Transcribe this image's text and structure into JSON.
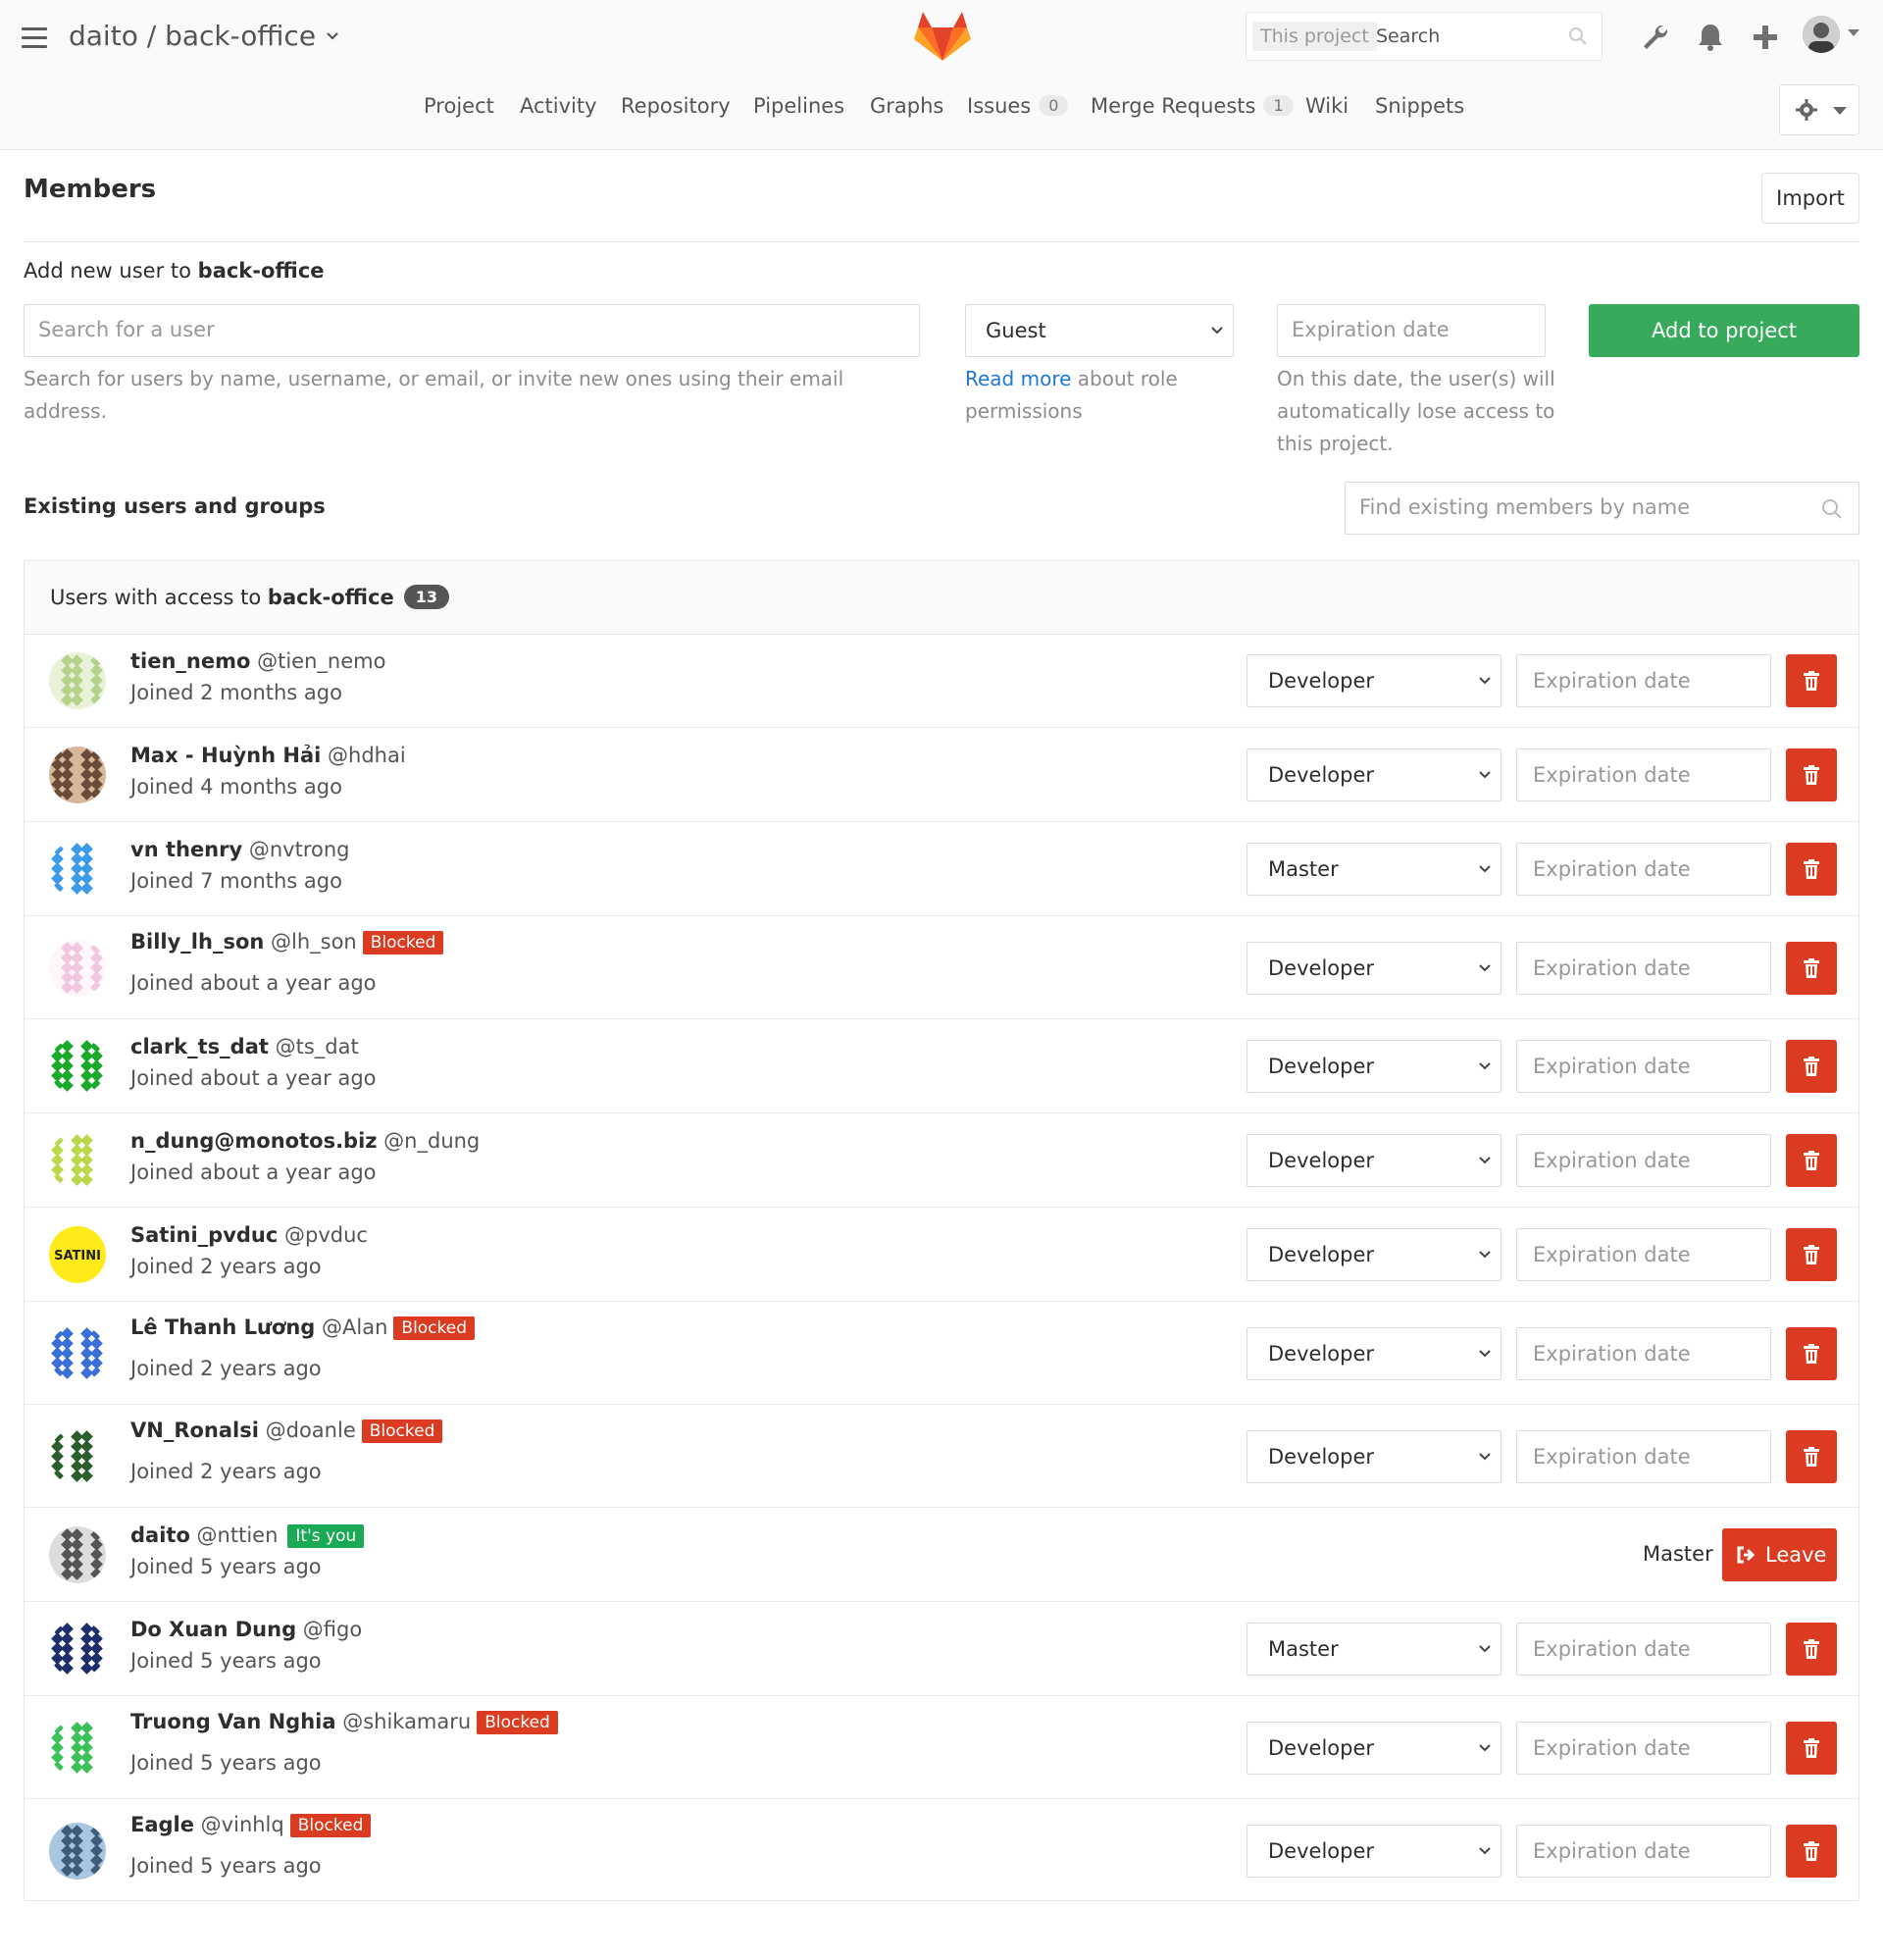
{
  "header": {
    "namespace": "daito",
    "separator": " / ",
    "project": "back-office",
    "search_scope": "This project",
    "search_placeholder": "Search",
    "icons": [
      "admin-wrench-icon",
      "bell-icon",
      "plus-icon",
      "user-avatar"
    ]
  },
  "nav": {
    "items": [
      {
        "label": "Project"
      },
      {
        "label": "Activity"
      },
      {
        "label": "Repository"
      },
      {
        "label": "Pipelines"
      },
      {
        "label": "Graphs"
      },
      {
        "label": "Issues",
        "count": "0"
      },
      {
        "label": "Merge Requests",
        "count": "1"
      },
      {
        "label": "Wiki"
      },
      {
        "label": "Snippets"
      }
    ]
  },
  "page": {
    "title": "Members",
    "import_label": "Import"
  },
  "add_user": {
    "label_prefix": "Add new user to ",
    "label_project": "back-office",
    "search_placeholder": "Search for a user",
    "search_help": "Search for users by name, username, or email, or invite new ones using their email address.",
    "role_value": "Guest",
    "role_help_link": "Read more",
    "role_help_rest": " about role permissions",
    "expiration_placeholder": "Expiration date",
    "expiration_help": "On this date, the user(s) will automatically lose access to this project.",
    "add_button": "Add to project"
  },
  "existing": {
    "label": "Existing users and groups",
    "find_placeholder": "Find existing members by name"
  },
  "members_panel": {
    "head_prefix": "Users with access to ",
    "head_project": "back-office",
    "count": "13",
    "expiration_placeholder": "Expiration date",
    "leave_label": "Leave",
    "members": [
      {
        "name": "tien_nemo",
        "handle": "@tien_nemo",
        "joined": "Joined 2 months ago",
        "role": "Developer",
        "blocked": "",
        "you": ""
      },
      {
        "name": "Max - Huỳnh Hải",
        "handle": "@hdhai",
        "joined": "Joined 4 months ago",
        "role": "Developer",
        "blocked": "",
        "you": ""
      },
      {
        "name": "vn thenry",
        "handle": "@nvtrong",
        "joined": "Joined 7 months ago",
        "role": "Master",
        "blocked": "",
        "you": ""
      },
      {
        "name": "Billy_lh_son",
        "handle": "@lh_son",
        "joined": "Joined about a year ago",
        "role": "Developer",
        "blocked": "Blocked",
        "you": ""
      },
      {
        "name": "clark_ts_dat",
        "handle": "@ts_dat",
        "joined": "Joined about a year ago",
        "role": "Developer",
        "blocked": "",
        "you": ""
      },
      {
        "name": "n_dung@monotos.biz",
        "handle": "@n_dung",
        "joined": "Joined about a year ago",
        "role": "Developer",
        "blocked": "",
        "you": ""
      },
      {
        "name": "Satini_pvduc",
        "handle": "@pvduc",
        "joined": "Joined 2 years ago",
        "role": "Developer",
        "blocked": "",
        "you": "",
        "avatar_text": "SATINI"
      },
      {
        "name": "Lê Thanh Lương",
        "handle": "@Alan",
        "joined": "Joined 2 years ago",
        "role": "Developer",
        "blocked": "Blocked",
        "you": ""
      },
      {
        "name": "VN_Ronalsi",
        "handle": "@doanle",
        "joined": "Joined 2 years ago",
        "role": "Developer",
        "blocked": "Blocked",
        "you": ""
      },
      {
        "name": "daito",
        "handle": "@nttien",
        "joined": "Joined 5 years ago",
        "role": "Master",
        "blocked": "",
        "you": "It's you"
      },
      {
        "name": "Do Xuan Dung",
        "handle": "@figo",
        "joined": "Joined 5 years ago",
        "role": "Master",
        "blocked": "",
        "you": ""
      },
      {
        "name": "Truong Van Nghia",
        "handle": "@shikamaru",
        "joined": "Joined 5 years ago",
        "role": "Developer",
        "blocked": "Blocked",
        "you": ""
      },
      {
        "name": "Eagle",
        "handle": "@vinhlq",
        "joined": "Joined 5 years ago",
        "role": "Developer",
        "blocked": "Blocked",
        "you": ""
      }
    ]
  },
  "colors": {
    "success": "#37ab5b",
    "danger": "#db3b21",
    "link": "#1f78d1",
    "logo": "#fc6d26"
  }
}
